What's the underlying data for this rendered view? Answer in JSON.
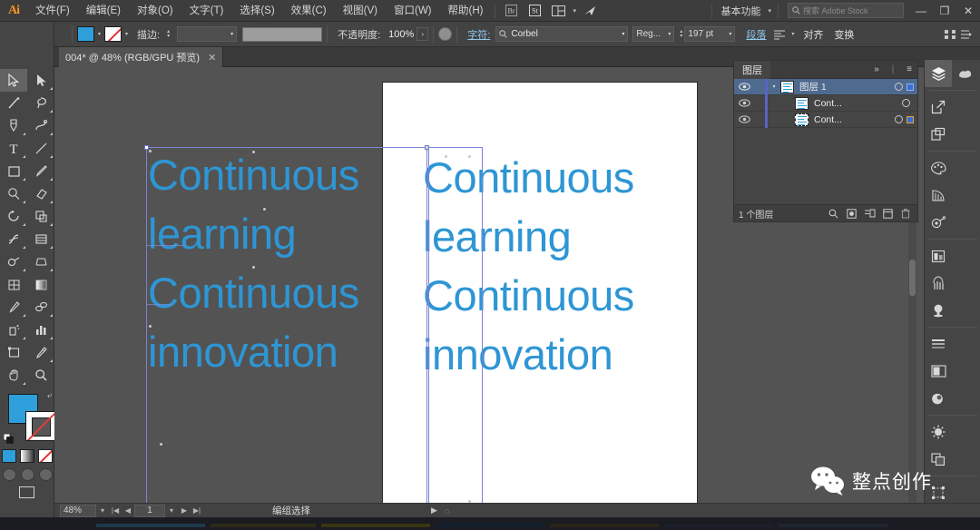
{
  "app": {
    "name": "Adobe Illustrator",
    "logo": "Ai"
  },
  "menubar": {
    "items": [
      {
        "label": "文件(F)",
        "name": "menu-file"
      },
      {
        "label": "编辑(E)",
        "name": "menu-edit"
      },
      {
        "label": "对象(O)",
        "name": "menu-object"
      },
      {
        "label": "文字(T)",
        "name": "menu-type"
      },
      {
        "label": "选择(S)",
        "name": "menu-select"
      },
      {
        "label": "效果(C)",
        "name": "menu-effect"
      },
      {
        "label": "视图(V)",
        "name": "menu-view"
      },
      {
        "label": "窗口(W)",
        "name": "menu-window"
      },
      {
        "label": "帮助(H)",
        "name": "menu-help"
      }
    ],
    "workspace": "基本功能",
    "stock_search_placeholder": "搜索 Adobe Stock",
    "win_minimize": "—",
    "win_restore": "❐",
    "win_close": "✕"
  },
  "controlbar": {
    "object_type": "文字",
    "fill_color": "#2e9fdb",
    "stroke_color": "#ffffff",
    "stroke_label": "描边:",
    "stroke_weight": "",
    "opacity_label": "不透明度:",
    "opacity_value": "100%",
    "character_label": "字符:",
    "font_family": "Corbel",
    "font_style": "Reg...",
    "font_size": "197 pt",
    "paragraph_label": "段落",
    "align_label": "对齐",
    "transform_label": "变换"
  },
  "tabs": [
    {
      "title": "004* @ 48% (RGB/GPU 预览)",
      "close": "✕",
      "active": true
    }
  ],
  "toolbar": {
    "tools": [
      {
        "name": "selection-tool",
        "selected": true
      },
      {
        "name": "direct-selection-tool",
        "selected": false
      },
      {
        "name": "magic-wand-tool",
        "selected": false
      },
      {
        "name": "lasso-tool",
        "selected": false
      },
      {
        "name": "pen-tool",
        "selected": false
      },
      {
        "name": "curvature-tool",
        "selected": false
      },
      {
        "name": "type-tool",
        "selected": false
      },
      {
        "name": "line-segment-tool",
        "selected": false
      },
      {
        "name": "rectangle-tool",
        "selected": false
      },
      {
        "name": "paintbrush-tool",
        "selected": false
      },
      {
        "name": "shaper-tool",
        "selected": false
      },
      {
        "name": "eraser-tool",
        "selected": false
      },
      {
        "name": "rotate-tool",
        "selected": false
      },
      {
        "name": "scale-tool",
        "selected": false
      },
      {
        "name": "width-tool",
        "selected": false
      },
      {
        "name": "free-transform-tool",
        "selected": false
      },
      {
        "name": "shape-builder-tool",
        "selected": false
      },
      {
        "name": "perspective-grid-tool",
        "selected": false
      },
      {
        "name": "mesh-tool",
        "selected": false
      },
      {
        "name": "gradient-tool",
        "selected": false
      },
      {
        "name": "eyedropper-tool",
        "selected": false
      },
      {
        "name": "blend-tool",
        "selected": false
      },
      {
        "name": "symbol-sprayer-tool",
        "selected": false
      },
      {
        "name": "column-graph-tool",
        "selected": false
      },
      {
        "name": "artboard-tool",
        "selected": false
      },
      {
        "name": "slice-tool",
        "selected": false
      },
      {
        "name": "hand-tool",
        "selected": false
      },
      {
        "name": "zoom-tool",
        "selected": false
      }
    ],
    "fill_color": "#2e9fdb",
    "stroke_color": "#ffffff",
    "stroke_none": true
  },
  "canvas": {
    "artboard_background": "#ffffff",
    "text_color": "#2e96d4",
    "text_lines": [
      "Continuous",
      " learning",
      "Continuous",
      "innovation"
    ],
    "selected_object_lines": [
      "Continuous",
      " learning",
      "Continuous",
      "innovation"
    ],
    "selection_border_color": "#7b82d4"
  },
  "layers_panel": {
    "title": "图层",
    "collapse_icon": "»",
    "menu_icon": "≡",
    "rows": [
      {
        "name": "图层 1",
        "selected": true,
        "visible": true,
        "expanded": true
      },
      {
        "name": "Cont...",
        "selected": false,
        "visible": true,
        "expanded": false
      },
      {
        "name": "Cont...",
        "selected": false,
        "visible": true,
        "expanded": false
      }
    ],
    "footer_count": "1 个图层",
    "footer_icons": [
      "locate-object-icon",
      "make-mask-icon",
      "new-sublayer-icon",
      "new-layer-icon",
      "delete-layer-icon"
    ]
  },
  "dock": {
    "items": [
      {
        "name": "layers-panel-icon",
        "active": true
      },
      {
        "name": "libraries-panel-icon",
        "active": false
      },
      {
        "name": "export-panel-icon",
        "active": false
      },
      {
        "name": "artboards-panel-icon",
        "active": false
      },
      {
        "name": "color-panel-icon",
        "active": false
      },
      {
        "name": "color-guide-panel-icon",
        "active": false
      },
      {
        "name": "gradient-panel-icon",
        "active": false
      },
      {
        "name": "image-trace-panel-icon",
        "active": false
      },
      {
        "name": "brushes-panel-icon",
        "active": false
      },
      {
        "name": "symbols-panel-icon",
        "active": false
      },
      {
        "name": "stroke-panel-icon",
        "active": false
      },
      {
        "name": "appearance-panel-icon",
        "active": false
      },
      {
        "name": "graphic-styles-panel-icon",
        "active": false
      },
      {
        "name": "transparency-panel-icon",
        "active": false
      },
      {
        "name": "pathfinder-panel-icon",
        "active": false
      },
      {
        "name": "transform-panel-icon",
        "active": false
      },
      {
        "name": "align-panel-icon",
        "active": false
      }
    ]
  },
  "statusbar": {
    "zoom": "48%",
    "page": "1",
    "status_text": "编组选择",
    "nav_first": "|◀",
    "nav_prev": "◀",
    "nav_next": "▶",
    "nav_last": "▶|"
  },
  "watermark": {
    "text": "整点创作",
    "icon": "wechat-icon"
  }
}
